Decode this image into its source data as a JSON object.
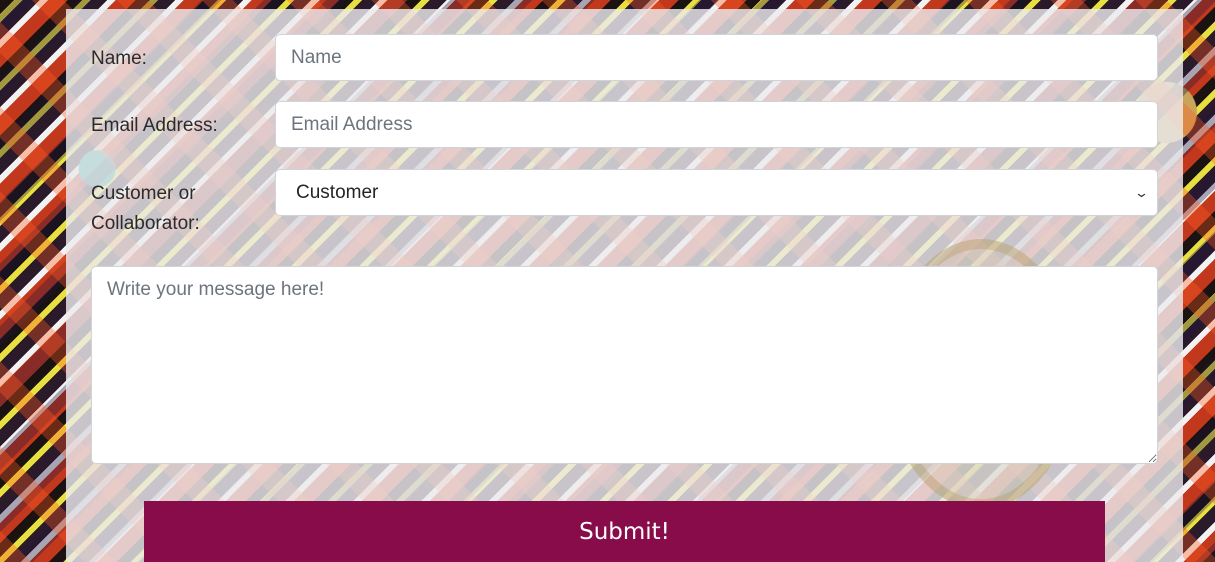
{
  "form": {
    "name": {
      "label": "Name:",
      "placeholder": "Name",
      "value": ""
    },
    "email": {
      "label": "Email Address:",
      "placeholder": "Email Address",
      "value": ""
    },
    "role": {
      "label": "Customer or Collaborator:",
      "selected": "Customer",
      "options": [
        "Customer"
      ]
    },
    "message": {
      "placeholder": "Write your message here!",
      "value": ""
    },
    "submit_label": "Submit!"
  },
  "colors": {
    "submit_bg": "#880c4a",
    "panel_bg": "rgba(236,234,238,0.82)"
  }
}
